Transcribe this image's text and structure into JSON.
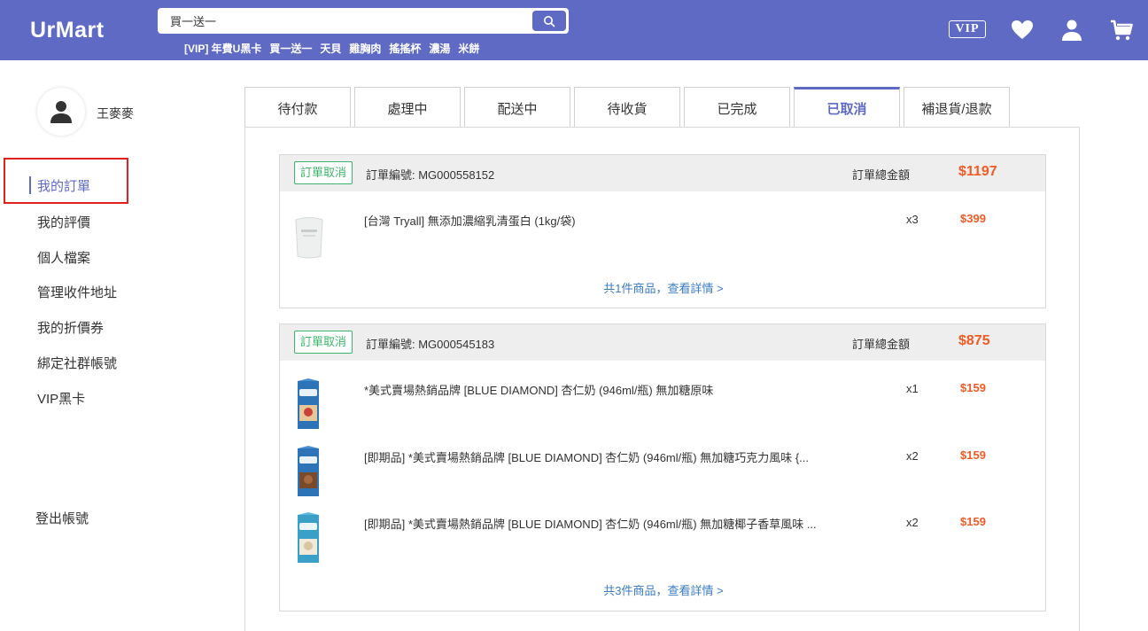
{
  "header": {
    "logo": "UrMart",
    "search_value": "買一送一",
    "hot_keywords": [
      "[VIP] 年費U黑卡",
      "買一送一",
      "天貝",
      "雞胸肉",
      "搖搖杯",
      "濃湯",
      "米餅"
    ],
    "vip_label": "VIP",
    "brand_color": "#5e6ac4"
  },
  "sidebar": {
    "username": "王麥麥",
    "items": [
      {
        "label": "我的訂單",
        "active": true
      },
      {
        "label": "我的評價"
      },
      {
        "label": "個人檔案"
      },
      {
        "label": "管理收件地址"
      },
      {
        "label": "我的折價券"
      },
      {
        "label": "綁定社群帳號"
      },
      {
        "label": "VIP黑卡"
      }
    ],
    "logout": "登出帳號"
  },
  "tabs": [
    {
      "label": "待付款"
    },
    {
      "label": "處理中"
    },
    {
      "label": "配送中"
    },
    {
      "label": "待收貨"
    },
    {
      "label": "已完成"
    },
    {
      "label": "已取消",
      "active": true
    },
    {
      "label": "補退貨/退款"
    }
  ],
  "orders": [
    {
      "status": "訂單取消",
      "order_no": "訂單編號: MG000558152",
      "total_label": "訂單總金額",
      "total": "$1197",
      "items": [
        {
          "name": "[台灣 Tryall] 無添加濃縮乳清蛋白 (1kg/袋)",
          "qty": "x3",
          "price": "$399"
        }
      ],
      "detail_link": "共1件商品，查看詳情 >"
    },
    {
      "status": "訂單取消",
      "order_no": "訂單編號: MG000545183",
      "total_label": "訂單總金額",
      "total": "$875",
      "items": [
        {
          "name": "*美式賣場熱銷品牌 [BLUE DIAMOND] 杏仁奶 (946ml/瓶) 無加糖原味",
          "qty": "x1",
          "price": "$159"
        },
        {
          "name": "[即期品] *美式賣場熱銷品牌 [BLUE DIAMOND] 杏仁奶 (946ml/瓶) 無加糖巧克力風味 {...",
          "qty": "x2",
          "price": "$159"
        },
        {
          "name": "[即期品] *美式賣場熱銷品牌 [BLUE DIAMOND] 杏仁奶 (946ml/瓶) 無加糖椰子香草風味 ...",
          "qty": "x2",
          "price": "$159"
        }
      ],
      "detail_link": "共3件商品，查看詳情 >"
    }
  ]
}
